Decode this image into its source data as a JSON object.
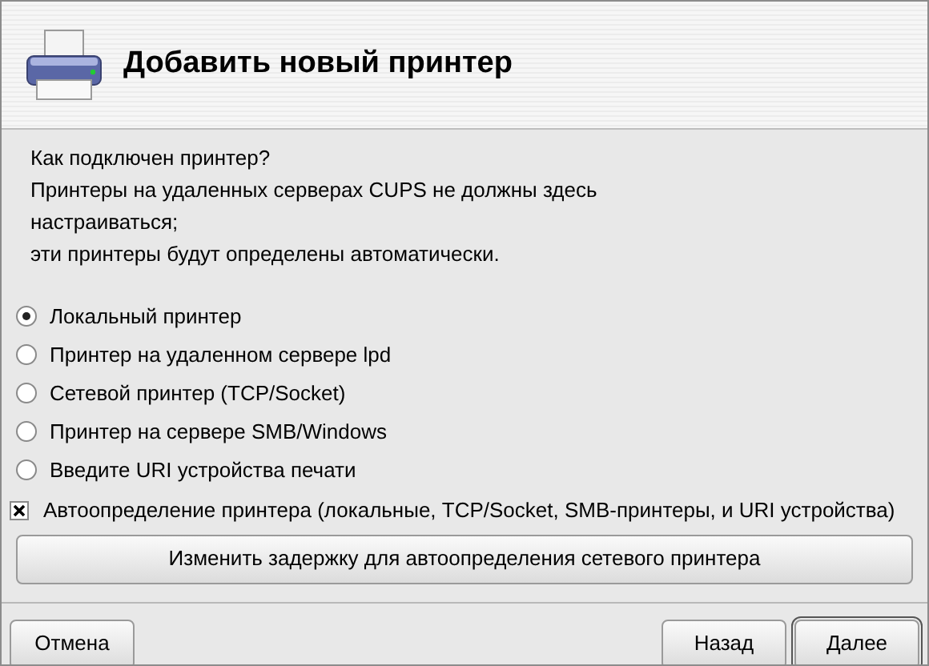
{
  "header": {
    "title": "Добавить новый принтер"
  },
  "intro": [
    "Как подключен принтер?",
    "Принтеры на удаленных серверах CUPS не должны здесь",
    "настраиваться;",
    "эти принтеры будут определены автоматически."
  ],
  "options": [
    {
      "label": "Локальный принтер",
      "selected": true
    },
    {
      "label": "Принтер на удаленном сервере lpd",
      "selected": false
    },
    {
      "label": "Сетевой принтер (TCP/Socket)",
      "selected": false
    },
    {
      "label": "Принтер на сервере SMB/Windows",
      "selected": false
    },
    {
      "label": "Введите URI устройства печати",
      "selected": false
    }
  ],
  "autodetect": {
    "label": "Автоопределение принтера (локальные, TCP/Socket, SMB-принтеры, и URI устройства)",
    "checked": true
  },
  "delay_button": "Изменить задержку для автоопределения сетевого принтера",
  "buttons": {
    "cancel": "Отмена",
    "back": "Назад",
    "next": "Далее"
  }
}
